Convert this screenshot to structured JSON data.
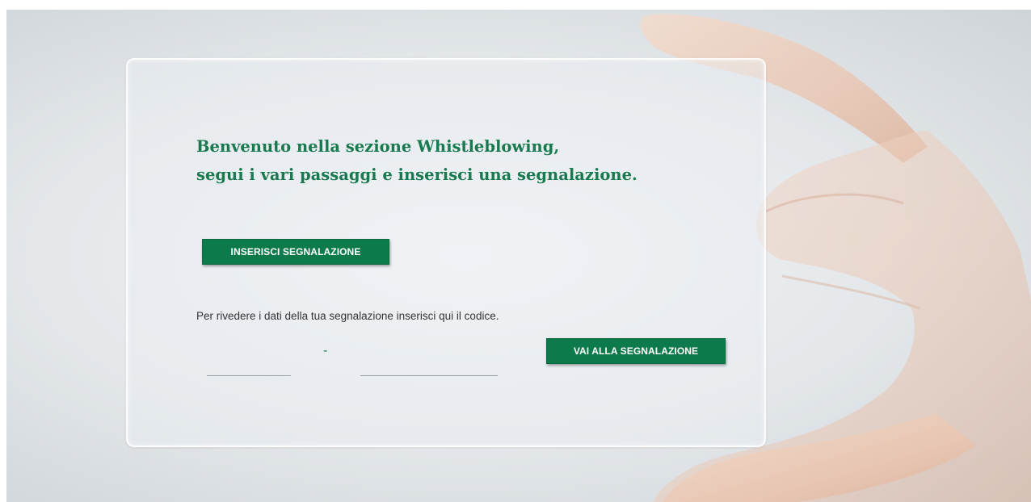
{
  "welcome": {
    "line1": "Benvenuto nella sezione Whistleblowing,",
    "line2": "segui i vari passaggi e inserisci una segnalazione."
  },
  "actions": {
    "insert_label": "INSERISCI SEGNALAZIONE",
    "goto_label": "VAI ALLA SEGNALAZIONE"
  },
  "review": {
    "text": "Per rivedere i dati della tua segnalazione inserisci qui il codice.",
    "code_part1": "",
    "code_part2": "",
    "separator": "-"
  },
  "colors": {
    "accent": "#0d7a4c",
    "heading": "#1a7a4f",
    "background": "#e3e7ea"
  }
}
